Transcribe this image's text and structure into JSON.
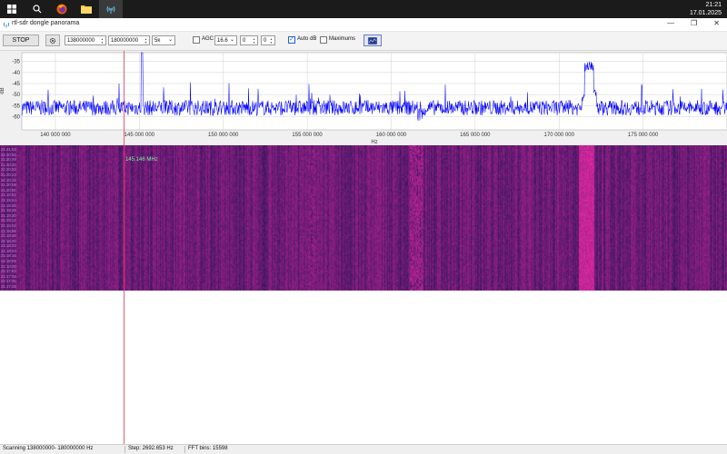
{
  "taskbar": {
    "icons": [
      "windows-logo-icon",
      "search-icon",
      "firefox-icon",
      "file-explorer-icon",
      "rtl-sdr-app-icon"
    ],
    "clock": {
      "time": "21:21",
      "date": "17.01.2025"
    }
  },
  "window": {
    "title": "rtl-sdr dongle panorama"
  },
  "toolbar": {
    "stop_label": "STOP",
    "start_freq": "138000000",
    "end_freq": "180000000",
    "step": "5k",
    "agc_label": "AGC",
    "agc_checked": false,
    "gain": "16.6",
    "offset1": "0",
    "offset2": "0",
    "auto_db_label": "Auto dB",
    "auto_db_checked": true,
    "maximums_label": "Maximums",
    "maximums_checked": false
  },
  "spectrum": {
    "ylabel": "dB",
    "xlabel": "Hz",
    "y_ticks": [
      "-35",
      "-40",
      "-45",
      "-50",
      "-55",
      "-60"
    ],
    "x_ticks": [
      "140 000 000",
      "145 000 000",
      "150 000 000",
      "155 000 000",
      "160 000 000",
      "165 000 000",
      "170 000 000",
      "175 000 000"
    ]
  },
  "chart_data": {
    "type": "line",
    "xlabel": "Hz",
    "ylabel": "dB",
    "xlim": [
      138000000,
      180000000
    ],
    "ylim": [
      -66,
      -31
    ],
    "grid": true,
    "noise_floor_db": -56,
    "signals": [
      {
        "freq_hz": 145146000,
        "peak_db": -31
      },
      {
        "freq_hz": 171800000,
        "peak_db": -35
      }
    ]
  },
  "waterfall": {
    "marker_label": "145.146 MHz",
    "time_labels": [
      "21:21:04",
      "21:20:56",
      "21:20:48",
      "21:20:40",
      "21:20:32",
      "21:20:24",
      "21:20:16",
      "21:20:08",
      "21:20:00",
      "21:19:52",
      "21:19:44",
      "21:19:36",
      "21:19:28",
      "21:19:20",
      "21:19:12",
      "21:19:04",
      "21:18:56",
      "21:18:48",
      "21:18:40",
      "21:18:32",
      "21:18:24",
      "21:18:16",
      "21:18:08",
      "21:18:00",
      "21:17:52",
      "21:17:44",
      "21:17:36",
      "21:17:28"
    ]
  },
  "status": {
    "scanning": "Scanning 138000000- 180000000 Hz",
    "step": "Step: 2692.653 Hz",
    "fft_bins": "FFT bins: 15598"
  },
  "colors": {
    "trace": "#0000ff",
    "waterfall_bg": "#2a1458",
    "marker": "#e0405a",
    "marker_text": "#7df59a"
  }
}
